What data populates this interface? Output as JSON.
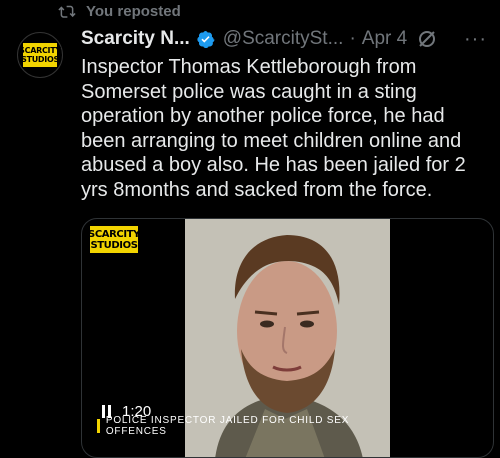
{
  "repost": {
    "label": "You reposted"
  },
  "author": {
    "display_name": "Scarcity N...",
    "handle": "@ScarcitySt...",
    "separator": "·",
    "date": "Apr 4",
    "avatar_logo_line1": "SCARCITY",
    "avatar_logo_line2": "STUDIOS"
  },
  "tweet": {
    "text": "Inspector Thomas Kettleborough from Somerset police was caught in a sting operation by another police force, he had been arranging to meet children online and abused a boy also. He has been jailed for 2 yrs 8months and sacked from the force."
  },
  "media": {
    "logo_line1": "SCARCITY",
    "logo_line2": "STUDIOS",
    "caption": "POLICE INSPECTOR JAILED FOR CHILD SEX OFFENCES",
    "timestamp": "1:20"
  },
  "icons": {
    "repost": "repost-icon",
    "verified": "verified-badge-icon",
    "grok": "grok-icon",
    "more": "more-icon",
    "pause": "pause-icon"
  },
  "colors": {
    "background": "#000000",
    "text": "#e7e9ea",
    "secondary": "#71767b",
    "verified": "#1d9bf0",
    "brand_yellow": "#f2d400"
  }
}
